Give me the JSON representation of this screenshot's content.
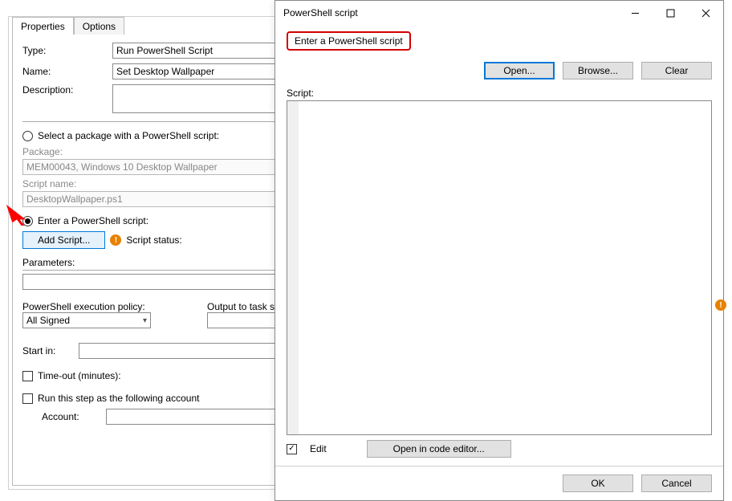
{
  "left": {
    "tabs": {
      "properties": "Properties",
      "options": "Options"
    },
    "type_label": "Type:",
    "type_value": "Run PowerShell Script",
    "name_label": "Name:",
    "name_value": "Set Desktop Wallpaper",
    "desc_label": "Description:",
    "desc_value": "",
    "radio_package": "Select a package with a PowerShell script:",
    "package_label": "Package:",
    "package_value": "MEM00043, Windows 10 Desktop Wallpaper",
    "scriptname_label": "Script name:",
    "scriptname_value": "DesktopWallpaper.ps1",
    "radio_enter": "Enter a PowerShell script:",
    "add_script": "Add Script...",
    "script_status": "Script status:",
    "parameters_label": "Parameters:",
    "parameters_value": "",
    "exec_policy_label": "PowerShell execution policy:",
    "exec_policy_value": "All Signed",
    "output_label": "Output to task sequence variable:",
    "output_value": "",
    "startin_label": "Start in:",
    "startin_value": "",
    "timeout_label": "Time-out (minutes):",
    "runas_label": "Run this step as the following account",
    "account_label": "Account:",
    "account_value": ""
  },
  "modal": {
    "title": "PowerShell script",
    "enter_caption": "Enter a PowerShell script",
    "open": "Open...",
    "browse": "Browse...",
    "clear": "Clear",
    "script_label": "Script:",
    "script_content": "",
    "edit_label": "Edit",
    "open_editor": "Open in code editor...",
    "ok": "OK",
    "cancel": "Cancel"
  }
}
